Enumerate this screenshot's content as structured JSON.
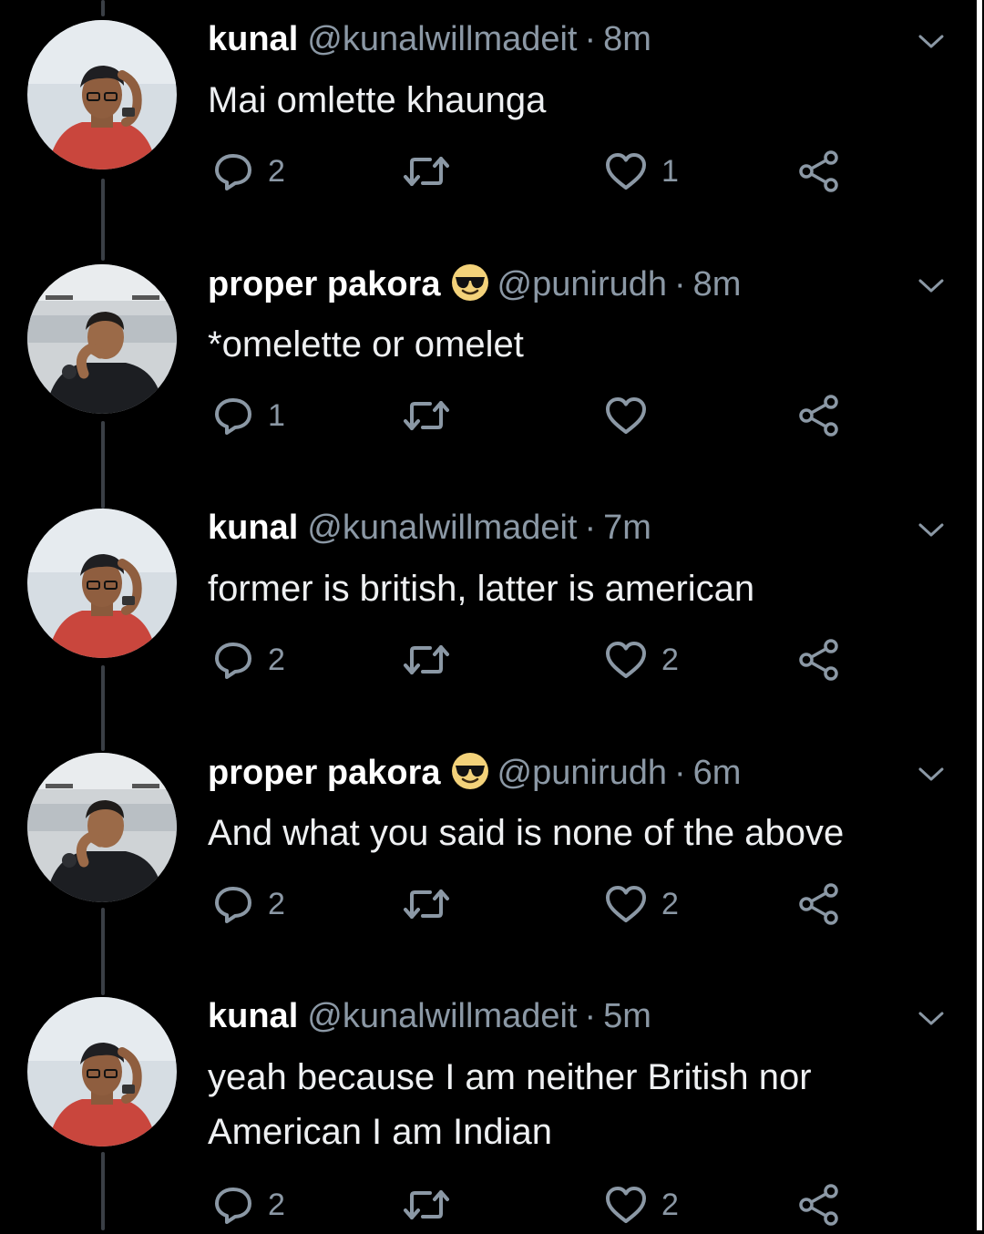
{
  "colors": {
    "background": "#000000",
    "text_primary": "#ffffff",
    "text_secondary": "#8b98a5",
    "thread_line": "#3a3f45"
  },
  "tweets": [
    {
      "name": "kunal",
      "has_emoji": false,
      "handle": "@kunalwillmadeit",
      "time": "8m",
      "text": "Mai omlette khaunga",
      "replies": "2",
      "retweets": "",
      "likes": "1",
      "avatar": "kunal-avatar"
    },
    {
      "name": "proper pakora",
      "has_emoji": true,
      "emoji": "sunglasses-emoji",
      "handle": "@punirudh",
      "time": "8m",
      "text": "*omelette or omelet",
      "replies": "1",
      "retweets": "",
      "likes": "",
      "avatar": "pakora-avatar"
    },
    {
      "name": "kunal",
      "has_emoji": false,
      "handle": "@kunalwillmadeit",
      "time": "7m",
      "text": "former is british, latter is american",
      "replies": "2",
      "retweets": "",
      "likes": "2",
      "avatar": "kunal-avatar"
    },
    {
      "name": "proper pakora",
      "has_emoji": true,
      "emoji": "sunglasses-emoji",
      "handle": "@punirudh",
      "time": "6m",
      "text": "And what you said is none of the above",
      "replies": "2",
      "retweets": "",
      "likes": "2",
      "avatar": "pakora-avatar"
    },
    {
      "name": "kunal",
      "has_emoji": false,
      "handle": "@kunalwillmadeit",
      "time": "5m",
      "text": "yeah because I am neither British nor American I am Indian",
      "replies": "2",
      "retweets": "",
      "likes": "2",
      "avatar": "kunal-avatar"
    }
  ],
  "separator": "·",
  "icons": [
    "reply-icon",
    "retweet-icon",
    "like-icon",
    "share-icon",
    "caret-down-icon"
  ]
}
